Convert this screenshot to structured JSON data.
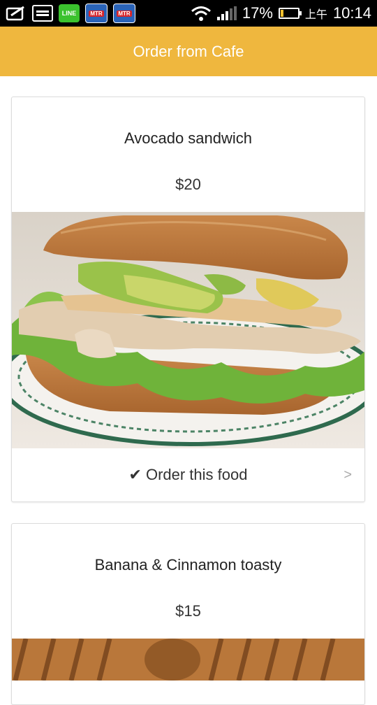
{
  "status_bar": {
    "icons": [
      "checkbox-pen-icon",
      "card-icon",
      "line-app-icon",
      "mtr-app-icon",
      "mtr-app-icon"
    ],
    "line_label": "LINE",
    "mtr_label": "MTR",
    "battery_percent": "17%",
    "battery_level": 0.17,
    "ampm": "上午",
    "time": "10:14"
  },
  "header": {
    "title": "Order from Cafe",
    "color": "#efb73e"
  },
  "cards": [
    {
      "name": "Avocado sandwich",
      "price": "$20",
      "image_icon": "sandwich-photo",
      "order_label": "Order this food",
      "chevron": ">"
    },
    {
      "name": "Banana & Cinnamon toasty",
      "price": "$15",
      "image_icon": "toast-photo"
    }
  ]
}
